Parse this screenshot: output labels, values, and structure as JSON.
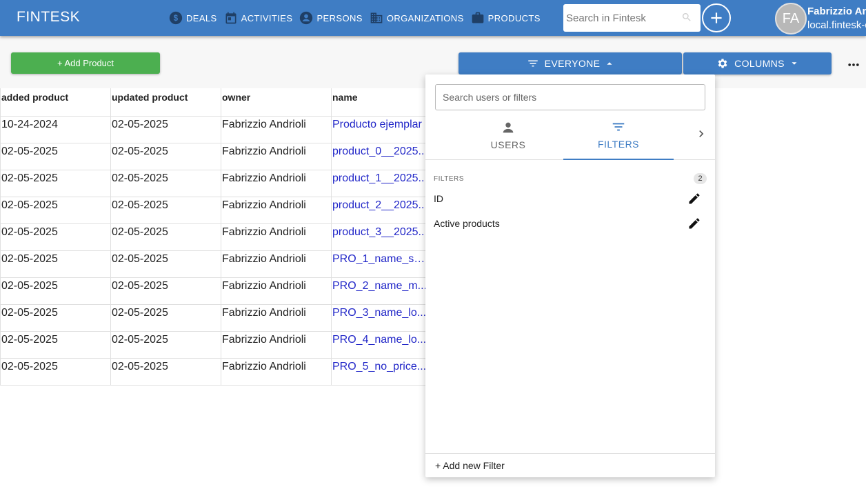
{
  "header": {
    "brand": "FINTESK",
    "nav": [
      {
        "label": "DEALS",
        "icon": "dollar-icon"
      },
      {
        "label": "ACTIVITIES",
        "icon": "calendar-icon"
      },
      {
        "label": "PERSONS",
        "icon": "person-icon"
      },
      {
        "label": "ORGANIZATIONS",
        "icon": "building-icon"
      },
      {
        "label": "PRODUCTS",
        "icon": "briefcase-icon"
      }
    ],
    "search_placeholder": "Search in Fintesk",
    "user": {
      "initials": "FA",
      "name": "Fabrizzio An",
      "domain": "local.fintesk-d"
    }
  },
  "toolbar": {
    "add_product": "+ Add Product",
    "everyone": "EVERYONE",
    "columns": "COLUMNS"
  },
  "table": {
    "headers": [
      "added product",
      "updated product",
      "owner",
      "name"
    ],
    "rows": [
      [
        "10-24-2024",
        "02-05-2025",
        "Fabrizzio Andrioli",
        "Producto ejemplar"
      ],
      [
        "02-05-2025",
        "02-05-2025",
        "Fabrizzio Andrioli",
        "product_0__2025..."
      ],
      [
        "02-05-2025",
        "02-05-2025",
        "Fabrizzio Andrioli",
        "product_1__2025..."
      ],
      [
        "02-05-2025",
        "02-05-2025",
        "Fabrizzio Andrioli",
        "product_2__2025..."
      ],
      [
        "02-05-2025",
        "02-05-2025",
        "Fabrizzio Andrioli",
        "product_3__2025..."
      ],
      [
        "02-05-2025",
        "02-05-2025",
        "Fabrizzio Andrioli",
        "PRO_1_name_sh..."
      ],
      [
        "02-05-2025",
        "02-05-2025",
        "Fabrizzio Andrioli",
        "PRO_2_name_m..."
      ],
      [
        "02-05-2025",
        "02-05-2025",
        "Fabrizzio Andrioli",
        "PRO_3_name_lo..."
      ],
      [
        "02-05-2025",
        "02-05-2025",
        "Fabrizzio Andrioli",
        "PRO_4_name_lo..."
      ],
      [
        "02-05-2025",
        "02-05-2025",
        "Fabrizzio Andrioli",
        "PRO_5_no_price..."
      ]
    ]
  },
  "dropdown": {
    "search_placeholder": "Search users or filters",
    "tabs": [
      {
        "label": "USERS"
      },
      {
        "label": "FILTERS"
      }
    ],
    "section_label": "FILTERS",
    "count": "2",
    "filters": [
      "ID",
      "Active products"
    ],
    "add_filter": "+ Add new Filter"
  },
  "colors": {
    "primary": "#3f7dc4",
    "success": "#4caf50",
    "link": "#2227c8"
  }
}
